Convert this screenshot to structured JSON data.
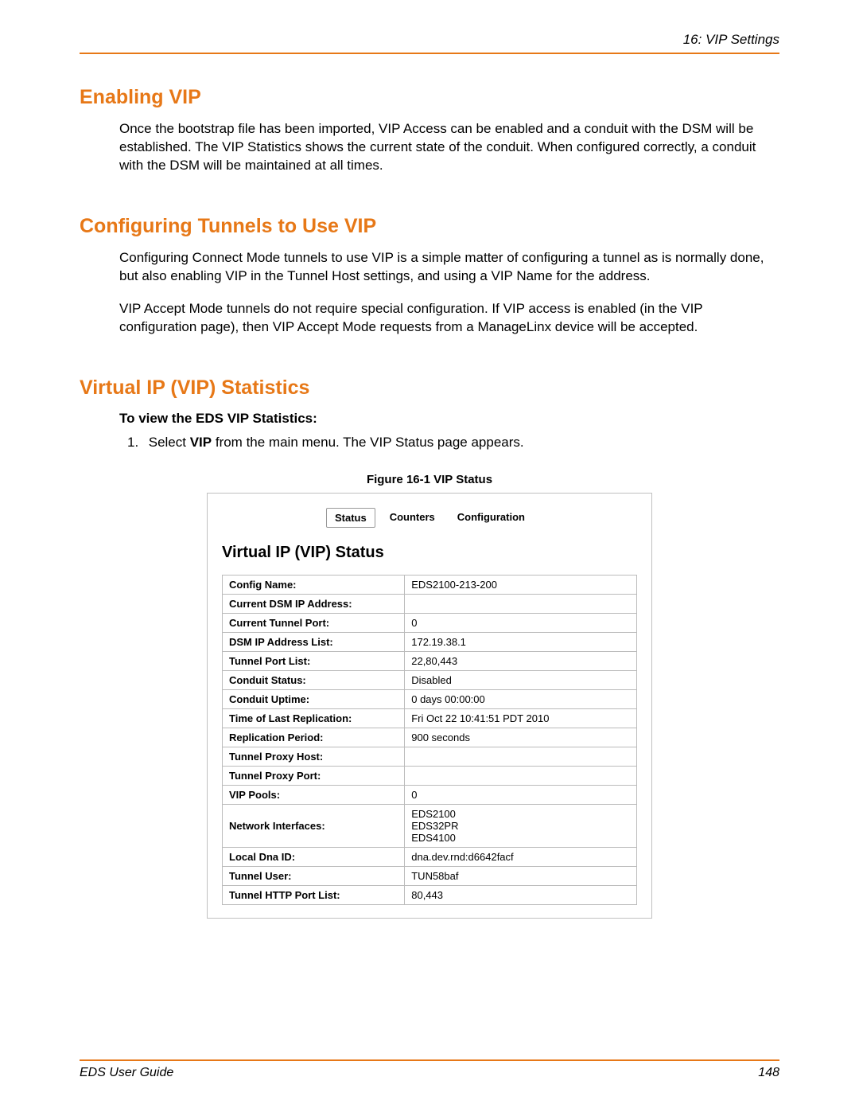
{
  "header": {
    "right": "16: VIP Settings"
  },
  "sections": {
    "enabling": {
      "title": "Enabling VIP",
      "p1": "Once the bootstrap file has been imported, VIP Access can be enabled and a conduit with the DSM will be established. The VIP Statistics shows the current state of the conduit. When configured correctly, a conduit with the DSM will be maintained at all times."
    },
    "tunnels": {
      "title": "Configuring Tunnels to Use VIP",
      "p1": "Configuring Connect Mode tunnels to use VIP is a simple matter of configuring a tunnel as is normally done, but also enabling VIP in the Tunnel Host settings, and using a VIP Name for the address.",
      "p2": "VIP Accept Mode tunnels do not require special configuration. If VIP access is enabled (in the VIP configuration page), then VIP Accept Mode requests from a ManageLinx device will be accepted."
    },
    "stats": {
      "title": "Virtual IP (VIP) Statistics",
      "intro": "To view the EDS VIP Statistics:",
      "step1_pre": "Select ",
      "step1_bold": "VIP",
      "step1_post": " from the main menu. The VIP Status page appears."
    }
  },
  "figure": {
    "caption": "Figure 16-1  VIP Status",
    "tabs": {
      "status": "Status",
      "counters": "Counters",
      "config": "Configuration"
    },
    "panel_title": "Virtual IP (VIP) Status",
    "rows": [
      {
        "k": "Config Name:",
        "v": "EDS2100-213-200"
      },
      {
        "k": "Current DSM IP Address:",
        "v": ""
      },
      {
        "k": "Current Tunnel Port:",
        "v": "0"
      },
      {
        "k": "DSM IP Address List:",
        "v": "172.19.38.1"
      },
      {
        "k": "Tunnel Port List:",
        "v": "22,80,443"
      },
      {
        "k": "Conduit Status:",
        "v": "Disabled"
      },
      {
        "k": "Conduit Uptime:",
        "v": "0 days 00:00:00"
      },
      {
        "k": "Time of Last Replication:",
        "v": "Fri Oct 22 10:41:51 PDT 2010"
      },
      {
        "k": "Replication Period:",
        "v": "900 seconds"
      },
      {
        "k": "Tunnel Proxy Host:",
        "v": ""
      },
      {
        "k": "Tunnel Proxy Port:",
        "v": ""
      },
      {
        "k": "VIP Pools:",
        "v": "0"
      },
      {
        "k": "Network Interfaces:",
        "v": "EDS2100\nEDS32PR\nEDS4100"
      },
      {
        "k": "Local Dna ID:",
        "v": "dna.dev.rnd:d6642facf"
      },
      {
        "k": "Tunnel User:",
        "v": "TUN58baf"
      },
      {
        "k": "Tunnel HTTP Port List:",
        "v": "80,443"
      }
    ]
  },
  "footer": {
    "left": "EDS User Guide",
    "right": "148"
  }
}
